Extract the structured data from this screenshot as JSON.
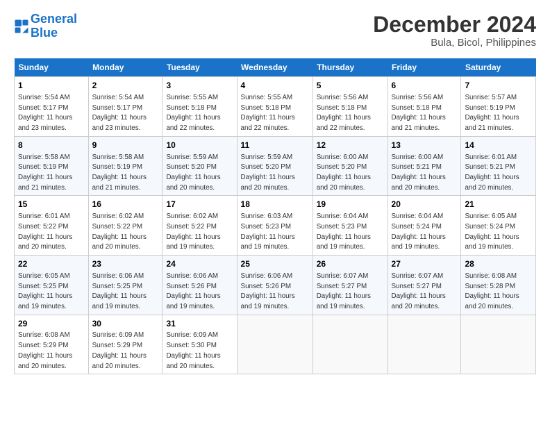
{
  "header": {
    "logo_line1": "General",
    "logo_line2": "Blue",
    "title": "December 2024",
    "subtitle": "Bula, Bicol, Philippines"
  },
  "days_of_week": [
    "Sunday",
    "Monday",
    "Tuesday",
    "Wednesday",
    "Thursday",
    "Friday",
    "Saturday"
  ],
  "weeks": [
    [
      {
        "day": "1",
        "info": "Sunrise: 5:54 AM\nSunset: 5:17 PM\nDaylight: 11 hours\nand 23 minutes."
      },
      {
        "day": "2",
        "info": "Sunrise: 5:54 AM\nSunset: 5:17 PM\nDaylight: 11 hours\nand 23 minutes."
      },
      {
        "day": "3",
        "info": "Sunrise: 5:55 AM\nSunset: 5:18 PM\nDaylight: 11 hours\nand 22 minutes."
      },
      {
        "day": "4",
        "info": "Sunrise: 5:55 AM\nSunset: 5:18 PM\nDaylight: 11 hours\nand 22 minutes."
      },
      {
        "day": "5",
        "info": "Sunrise: 5:56 AM\nSunset: 5:18 PM\nDaylight: 11 hours\nand 22 minutes."
      },
      {
        "day": "6",
        "info": "Sunrise: 5:56 AM\nSunset: 5:18 PM\nDaylight: 11 hours\nand 21 minutes."
      },
      {
        "day": "7",
        "info": "Sunrise: 5:57 AM\nSunset: 5:19 PM\nDaylight: 11 hours\nand 21 minutes."
      }
    ],
    [
      {
        "day": "8",
        "info": "Sunrise: 5:58 AM\nSunset: 5:19 PM\nDaylight: 11 hours\nand 21 minutes."
      },
      {
        "day": "9",
        "info": "Sunrise: 5:58 AM\nSunset: 5:19 PM\nDaylight: 11 hours\nand 21 minutes."
      },
      {
        "day": "10",
        "info": "Sunrise: 5:59 AM\nSunset: 5:20 PM\nDaylight: 11 hours\nand 20 minutes."
      },
      {
        "day": "11",
        "info": "Sunrise: 5:59 AM\nSunset: 5:20 PM\nDaylight: 11 hours\nand 20 minutes."
      },
      {
        "day": "12",
        "info": "Sunrise: 6:00 AM\nSunset: 5:20 PM\nDaylight: 11 hours\nand 20 minutes."
      },
      {
        "day": "13",
        "info": "Sunrise: 6:00 AM\nSunset: 5:21 PM\nDaylight: 11 hours\nand 20 minutes."
      },
      {
        "day": "14",
        "info": "Sunrise: 6:01 AM\nSunset: 5:21 PM\nDaylight: 11 hours\nand 20 minutes."
      }
    ],
    [
      {
        "day": "15",
        "info": "Sunrise: 6:01 AM\nSunset: 5:22 PM\nDaylight: 11 hours\nand 20 minutes."
      },
      {
        "day": "16",
        "info": "Sunrise: 6:02 AM\nSunset: 5:22 PM\nDaylight: 11 hours\nand 20 minutes."
      },
      {
        "day": "17",
        "info": "Sunrise: 6:02 AM\nSunset: 5:22 PM\nDaylight: 11 hours\nand 19 minutes."
      },
      {
        "day": "18",
        "info": "Sunrise: 6:03 AM\nSunset: 5:23 PM\nDaylight: 11 hours\nand 19 minutes."
      },
      {
        "day": "19",
        "info": "Sunrise: 6:04 AM\nSunset: 5:23 PM\nDaylight: 11 hours\nand 19 minutes."
      },
      {
        "day": "20",
        "info": "Sunrise: 6:04 AM\nSunset: 5:24 PM\nDaylight: 11 hours\nand 19 minutes."
      },
      {
        "day": "21",
        "info": "Sunrise: 6:05 AM\nSunset: 5:24 PM\nDaylight: 11 hours\nand 19 minutes."
      }
    ],
    [
      {
        "day": "22",
        "info": "Sunrise: 6:05 AM\nSunset: 5:25 PM\nDaylight: 11 hours\nand 19 minutes."
      },
      {
        "day": "23",
        "info": "Sunrise: 6:06 AM\nSunset: 5:25 PM\nDaylight: 11 hours\nand 19 minutes."
      },
      {
        "day": "24",
        "info": "Sunrise: 6:06 AM\nSunset: 5:26 PM\nDaylight: 11 hours\nand 19 minutes."
      },
      {
        "day": "25",
        "info": "Sunrise: 6:06 AM\nSunset: 5:26 PM\nDaylight: 11 hours\nand 19 minutes."
      },
      {
        "day": "26",
        "info": "Sunrise: 6:07 AM\nSunset: 5:27 PM\nDaylight: 11 hours\nand 19 minutes."
      },
      {
        "day": "27",
        "info": "Sunrise: 6:07 AM\nSunset: 5:27 PM\nDaylight: 11 hours\nand 20 minutes."
      },
      {
        "day": "28",
        "info": "Sunrise: 6:08 AM\nSunset: 5:28 PM\nDaylight: 11 hours\nand 20 minutes."
      }
    ],
    [
      {
        "day": "29",
        "info": "Sunrise: 6:08 AM\nSunset: 5:29 PM\nDaylight: 11 hours\nand 20 minutes."
      },
      {
        "day": "30",
        "info": "Sunrise: 6:09 AM\nSunset: 5:29 PM\nDaylight: 11 hours\nand 20 minutes."
      },
      {
        "day": "31",
        "info": "Sunrise: 6:09 AM\nSunset: 5:30 PM\nDaylight: 11 hours\nand 20 minutes."
      },
      null,
      null,
      null,
      null
    ]
  ]
}
